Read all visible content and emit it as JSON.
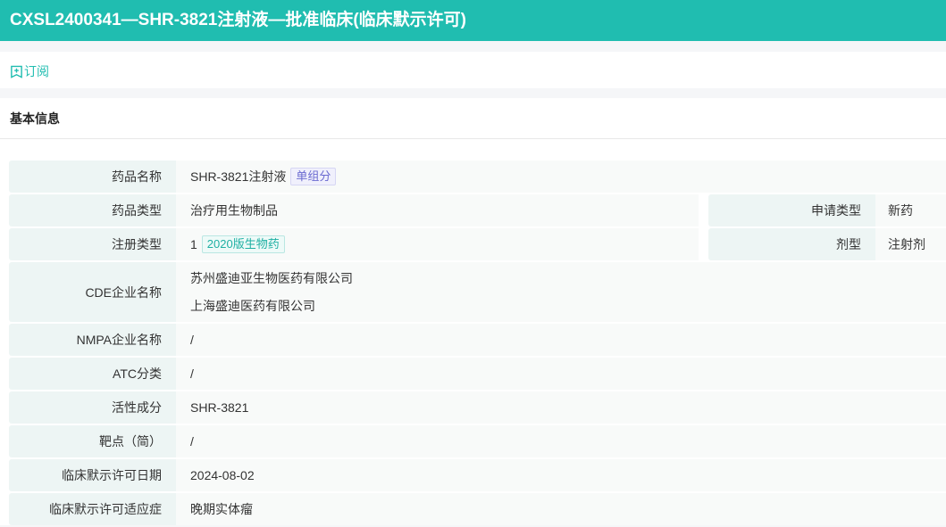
{
  "header": {
    "title": "CXSL2400341—SHR-3821注射液—批准临床(临床默示许可)"
  },
  "toolbar": {
    "subscribe_label": "订阅"
  },
  "section": {
    "title": "基本信息"
  },
  "fields": {
    "drug_name": {
      "label": "药品名称",
      "value": "SHR-3821注射液",
      "tag": "单组分"
    },
    "drug_type": {
      "label": "药品类型",
      "value": "治疗用生物制品"
    },
    "apply_type": {
      "label": "申请类型",
      "value": "新药"
    },
    "reg_type": {
      "label": "注册类型",
      "value": "1",
      "tag": "2020版生物药"
    },
    "dosage_form": {
      "label": "剂型",
      "value": "注射剂"
    },
    "cde_company": {
      "label": "CDE企业名称",
      "values": [
        "苏州盛迪亚生物医药有限公司",
        "上海盛迪医药有限公司"
      ]
    },
    "nmpa_company": {
      "label": "NMPA企业名称",
      "value": "/"
    },
    "atc": {
      "label": "ATC分类",
      "value": "/"
    },
    "active": {
      "label": "活性成分",
      "value": "SHR-3821"
    },
    "target": {
      "label": "靶点（简）",
      "value": "/"
    },
    "approval_date": {
      "label": "临床默示许可日期",
      "value": "2024-08-02"
    },
    "indication": {
      "label": "临床默示许可适应症",
      "value": "晚期实体瘤"
    }
  }
}
